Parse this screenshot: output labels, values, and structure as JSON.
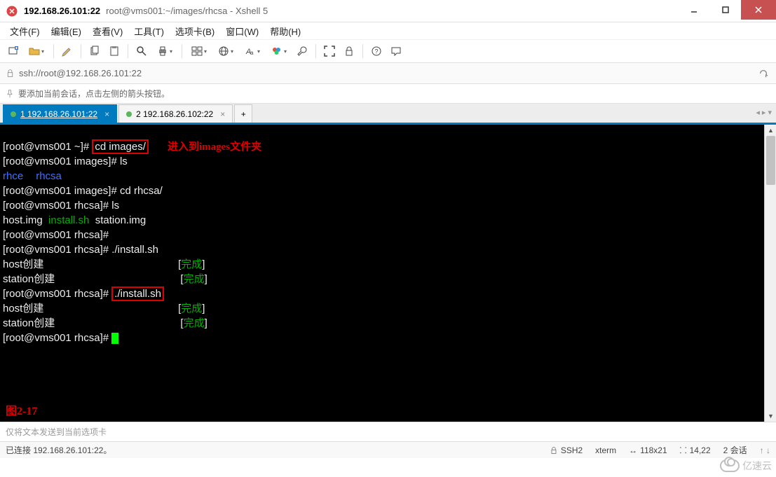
{
  "window": {
    "ip": "192.168.26.101:22",
    "path": "root@vms001:~/images/rhcsa - Xshell 5"
  },
  "menu": {
    "file": "文件(F)",
    "edit": "编辑(E)",
    "view": "查看(V)",
    "tools": "工具(T)",
    "tabs_menu": "选项卡(B)",
    "window": "窗口(W)",
    "help": "帮助(H)"
  },
  "toolbar_icons": {
    "new": "new-session-icon",
    "open": "open-icon",
    "props": "properties-icon",
    "copy": "copy-icon",
    "paste": "paste-icon",
    "find": "find-icon",
    "print": "print-icon",
    "view": "view-icon",
    "globe": "globe-icon",
    "font": "font-icon",
    "color": "color-icon",
    "tools": "tools-icon",
    "fullscreen": "fullscreen-icon",
    "lock": "lock-icon",
    "help": "help-icon",
    "feedback": "feedback-icon"
  },
  "addressbar": {
    "url": "ssh://root@192.168.26.101:22"
  },
  "tipbar": {
    "text": "要添加当前会话，点击左侧的箭头按钮。"
  },
  "tabs": [
    {
      "label": "1 192.168.26.101:22",
      "active": true
    },
    {
      "label": "2 192.168.26.102:22",
      "active": false
    }
  ],
  "terminal": {
    "l1_prompt": "[root@vms001 ~]# ",
    "l1_cmd": "cd images/",
    "l1_anno": "进入到images文件夹",
    "l2": "[root@vms001 images]# ls",
    "l3a": "rhce",
    "l3b": "rhcsa",
    "l4": "[root@vms001 images]# cd rhcsa/",
    "l5": "[root@vms001 rhcsa]# ls",
    "l6a": "host.img  ",
    "l6b": "install.sh",
    "l6c": "  station.img",
    "l7": "[root@vms001 rhcsa]#",
    "l8": "[root@vms001 rhcsa]# ./install.sh",
    "l9a": "host创建",
    "l9pad": "                                              [",
    "l9b": "完成",
    "l9c": "]",
    "l10a": "station创建",
    "l10pad": "                                           [",
    "l11_prompt": "[root@vms001 rhcsa]# ",
    "l11_cmd": "./install.sh",
    "l14": "[root@vms001 rhcsa]# ",
    "fig_label": "图2-17"
  },
  "footer": {
    "placeholder": "仅将文本发送到当前选项卡"
  },
  "status": {
    "conn": "已连接 192.168.26.101:22。",
    "proto": "SSH2",
    "term": "xterm",
    "size": "118x21",
    "pos": "14,22",
    "sessions": "2 会话"
  },
  "watermark": {
    "text": "亿速云"
  }
}
